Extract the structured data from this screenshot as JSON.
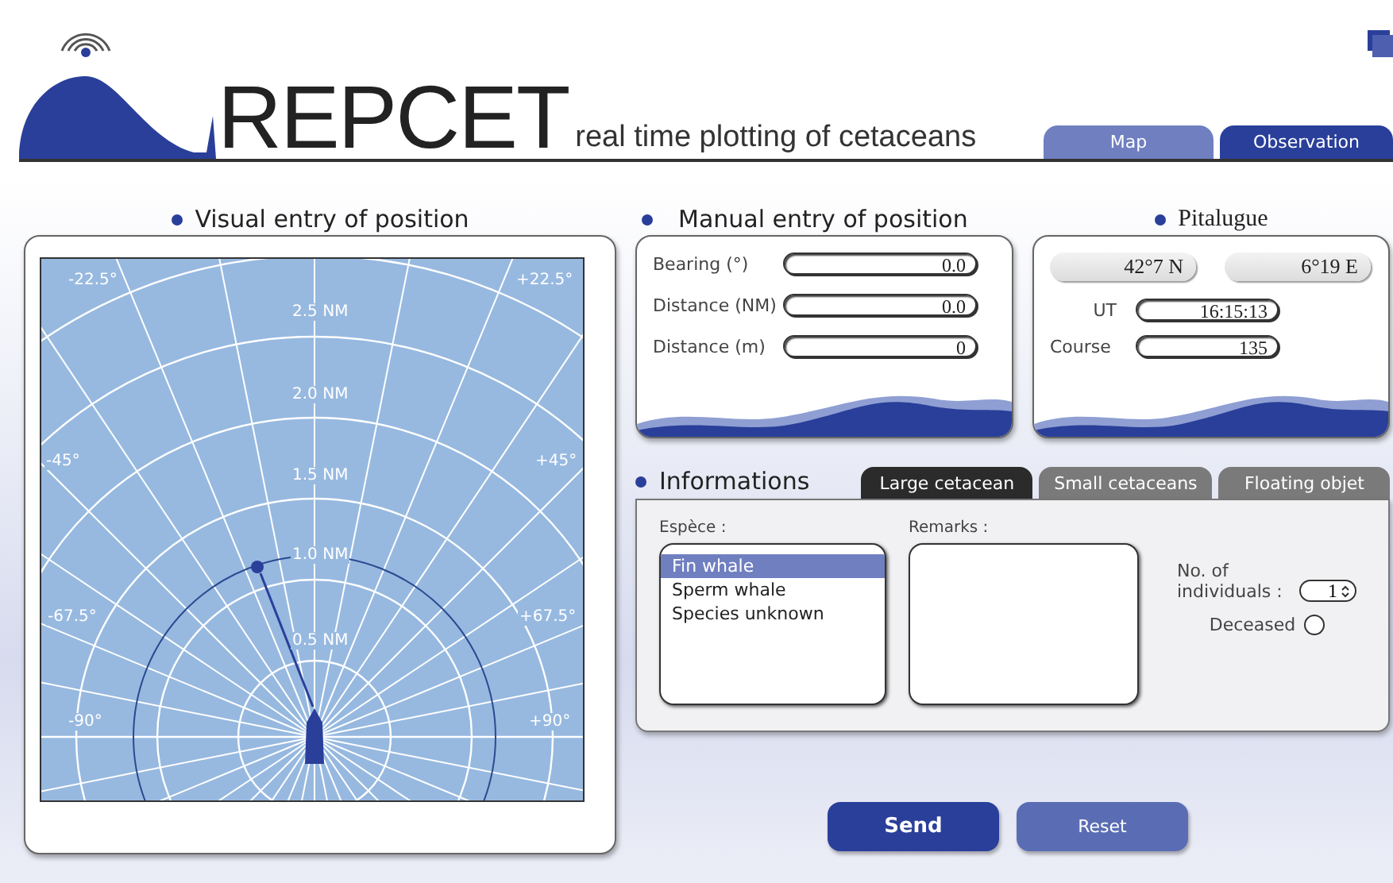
{
  "header": {
    "logo_text": "REPCET",
    "tagline": "real time plotting of cetaceans",
    "tabs": [
      {
        "label": "Map",
        "selected": false
      },
      {
        "label": "Observation",
        "selected": true
      }
    ]
  },
  "visual_entry": {
    "title": "Visual entry of position",
    "ring_labels": [
      "2.5 NM",
      "2.0 NM",
      "1.5 NM",
      "1.0 NM",
      "0.5 NM"
    ],
    "angle_labels": [
      "-22.5°",
      "+22.5°",
      "-45°",
      "+45°",
      "-67.5°",
      "+67.5°",
      "-90°",
      "+90°"
    ]
  },
  "manual_entry": {
    "title": "Manual entry of position",
    "fields": [
      {
        "label": "Bearing  (°)",
        "value": "0.0"
      },
      {
        "label": "Distance (NM)",
        "value": "0.0"
      },
      {
        "label": "Distance (m)",
        "value": "0"
      }
    ]
  },
  "vessel": {
    "title": "Pitalugue",
    "latitude": "42°7 N",
    "longitude": "6°19 E",
    "fields": [
      {
        "label": "UT",
        "value": "16:15:13"
      },
      {
        "label": "Course",
        "value": "135"
      }
    ]
  },
  "informations": {
    "title": "Informations",
    "tabs": [
      {
        "label": "Large cetacean",
        "selected": true
      },
      {
        "label": "Small cetaceans",
        "selected": false
      },
      {
        "label": "Floating objet",
        "selected": false
      }
    ],
    "species_label": "Espèce :",
    "species": [
      {
        "label": "Fin whale",
        "selected": true
      },
      {
        "label": "Sperm whale",
        "selected": false
      },
      {
        "label": "Species unknown",
        "selected": false
      }
    ],
    "remarks_label": "Remarks  :",
    "individuals_label": "No. of individuals :",
    "individuals_value": "1",
    "deceased_label": "Deceased",
    "deceased_checked": false
  },
  "buttons": [
    {
      "label": "Send",
      "kind": "primary"
    },
    {
      "label": "Reset",
      "kind": "secondary"
    }
  ]
}
